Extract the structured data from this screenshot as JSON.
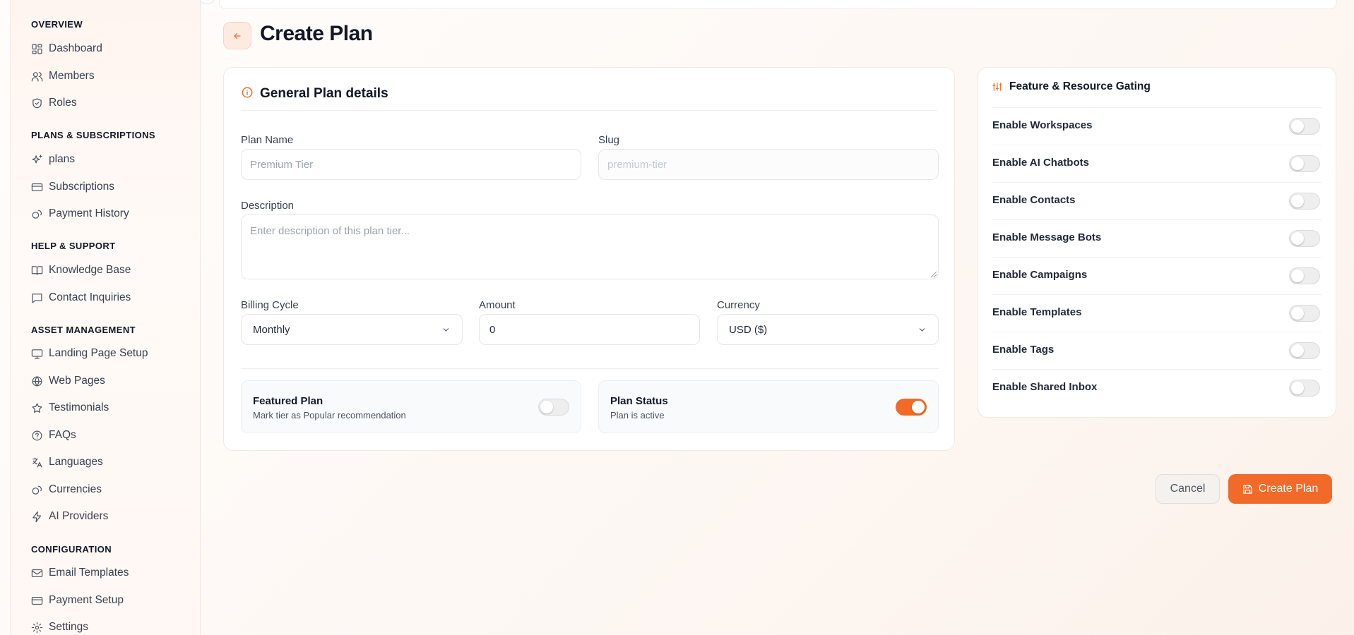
{
  "sidebar": {
    "sections": [
      {
        "title": "OVERVIEW",
        "items": [
          {
            "label": "Dashboard",
            "icon": "dashboard-icon"
          },
          {
            "label": "Members",
            "icon": "users-icon"
          },
          {
            "label": "Roles",
            "icon": "shield-icon"
          }
        ]
      },
      {
        "title": "PLANS & SUBSCRIPTIONS",
        "items": [
          {
            "label": "plans",
            "icon": "sparkles-icon"
          },
          {
            "label": "Subscriptions",
            "icon": "credit-card-icon"
          },
          {
            "label": "Payment History",
            "icon": "coins-icon"
          }
        ]
      },
      {
        "title": "HELP & SUPPORT",
        "items": [
          {
            "label": "Knowledge Base",
            "icon": "book-icon"
          },
          {
            "label": "Contact Inquiries",
            "icon": "message-icon"
          }
        ]
      },
      {
        "title": "ASSET MANAGEMENT",
        "items": [
          {
            "label": "Landing Page Setup",
            "icon": "monitor-icon"
          },
          {
            "label": "Web Pages",
            "icon": "globe-icon"
          },
          {
            "label": "Testimonials",
            "icon": "star-icon"
          },
          {
            "label": "FAQs",
            "icon": "help-circle-icon"
          },
          {
            "label": "Languages",
            "icon": "languages-icon"
          },
          {
            "label": "Currencies",
            "icon": "coins-icon"
          },
          {
            "label": "AI Providers",
            "icon": "zap-icon"
          }
        ]
      },
      {
        "title": "CONFIGURATION",
        "items": [
          {
            "label": "Email Templates",
            "icon": "mail-icon"
          },
          {
            "label": "Payment Setup",
            "icon": "credit-card-icon"
          },
          {
            "label": "Settings",
            "icon": "gear-icon"
          }
        ]
      }
    ]
  },
  "header": {
    "title": "Create Plan"
  },
  "general": {
    "title": "General Plan details",
    "plan_name_label": "Plan Name",
    "plan_name_placeholder": "Premium Tier",
    "slug_label": "Slug",
    "slug_placeholder": "premium-tier",
    "description_label": "Description",
    "description_placeholder": "Enter description of this plan tier...",
    "billing_cycle_label": "Billing Cycle",
    "billing_cycle_value": "Monthly",
    "amount_label": "Amount",
    "amount_value": "0",
    "currency_label": "Currency",
    "currency_value": "USD ($)",
    "featured_title": "Featured Plan",
    "featured_sub": "Mark tier as Popular recommendation",
    "featured_on": false,
    "status_title": "Plan Status",
    "status_sub": "Plan is active",
    "status_on": true
  },
  "gating": {
    "title": "Feature & Resource Gating",
    "features": [
      {
        "label": "Enable Workspaces",
        "on": false
      },
      {
        "label": "Enable AI Chatbots",
        "on": false
      },
      {
        "label": "Enable Contacts",
        "on": false
      },
      {
        "label": "Enable Message Bots",
        "on": false
      },
      {
        "label": "Enable Campaigns",
        "on": false
      },
      {
        "label": "Enable Templates",
        "on": false
      },
      {
        "label": "Enable Tags",
        "on": false
      },
      {
        "label": "Enable Shared Inbox",
        "on": false
      }
    ]
  },
  "actions": {
    "cancel_label": "Cancel",
    "create_label": "Create Plan"
  },
  "colors": {
    "accent": "#f26a2a",
    "text": "#111827"
  }
}
